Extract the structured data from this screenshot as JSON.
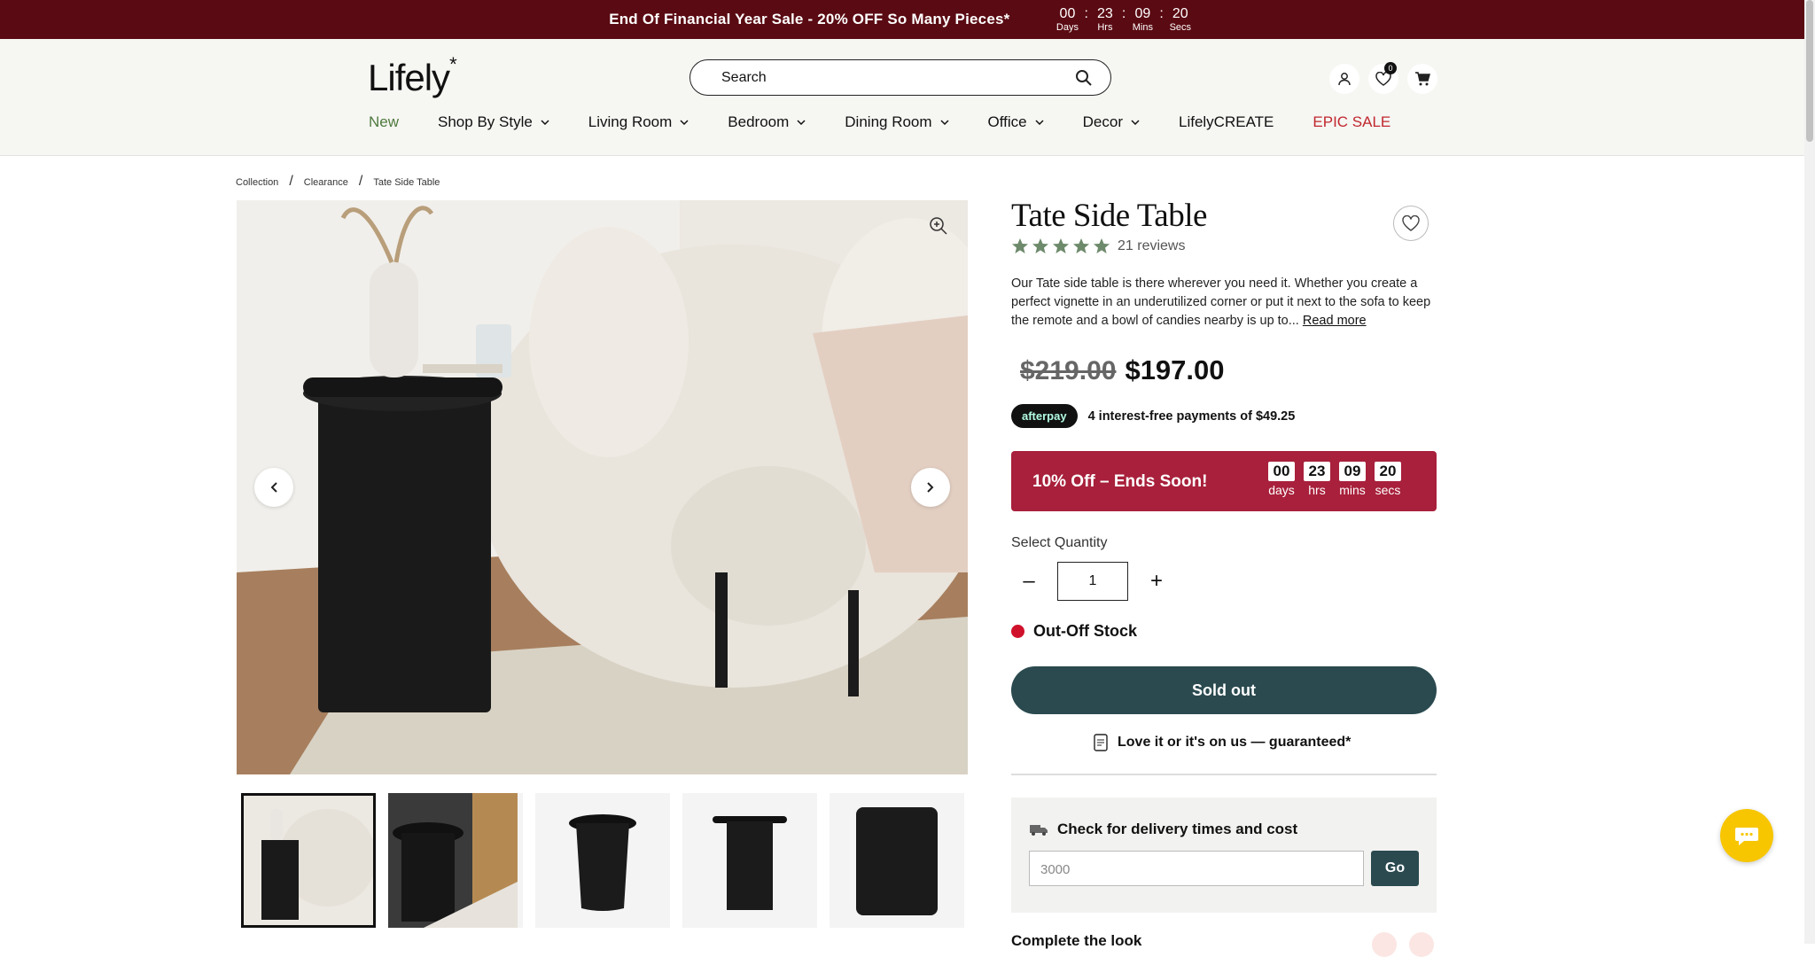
{
  "announcement": {
    "message": "End Of Financial Year Sale - 20% OFF So Many Pieces*",
    "countdown": [
      {
        "value": "00",
        "label": "Days"
      },
      {
        "value": "23",
        "label": "Hrs"
      },
      {
        "value": "09",
        "label": "Mins"
      },
      {
        "value": "20",
        "label": "Secs"
      }
    ]
  },
  "header": {
    "logo": "Lifely",
    "logo_mark": "*",
    "search_placeholder": "Search",
    "wishlist_count": "0",
    "nav": [
      {
        "label": "New"
      },
      {
        "label": "Shop By Style"
      },
      {
        "label": "Living Room"
      },
      {
        "label": "Bedroom"
      },
      {
        "label": "Dining Room"
      },
      {
        "label": "Office"
      },
      {
        "label": "Decor"
      },
      {
        "label": "LifelyCREATE"
      },
      {
        "label": "EPIC SALE"
      }
    ]
  },
  "breadcrumb": [
    "Collection",
    "Clearance",
    "Tate Side Table"
  ],
  "product": {
    "title": "Tate Side Table",
    "reviews": "21 reviews",
    "rating": 5,
    "description": "Our Tate side table is there wherever you need it. Whether you create a perfect vignette in an underutilized corner or put it next to the sofa to keep the remote and a bowl of candies nearby is up to...",
    "read_more": "Read more",
    "old_price": "$219.00",
    "price": "$197.00",
    "afterpay_logo": "afterpay",
    "afterpay_text": "4 interest-free payments of $49.25",
    "promo": {
      "title": "10% Off – Ends Soon!",
      "countdown": [
        {
          "value": "00",
          "label": "days"
        },
        {
          "value": "23",
          "label": "hrs"
        },
        {
          "value": "09",
          "label": "mins"
        },
        {
          "value": "20",
          "label": "secs"
        }
      ]
    },
    "quantity_label": "Select Quantity",
    "quantity": "1",
    "minus": "–",
    "plus": "+",
    "stock": "Out-Off Stock",
    "button": "Sold out",
    "guarantee": "Love it or it's on us — guaranteed*",
    "delivery_title": "Check for delivery times and cost",
    "postcode_placeholder": "3000",
    "go": "Go",
    "next_section": "Complete the look"
  },
  "colors": {
    "announcement_bg": "#5a0a12",
    "promo_bg": "#a8203b",
    "button_bg": "#2a4a4f",
    "star": "#6d8a6b",
    "sale": "#c0272d",
    "chat": "#f7c600"
  }
}
